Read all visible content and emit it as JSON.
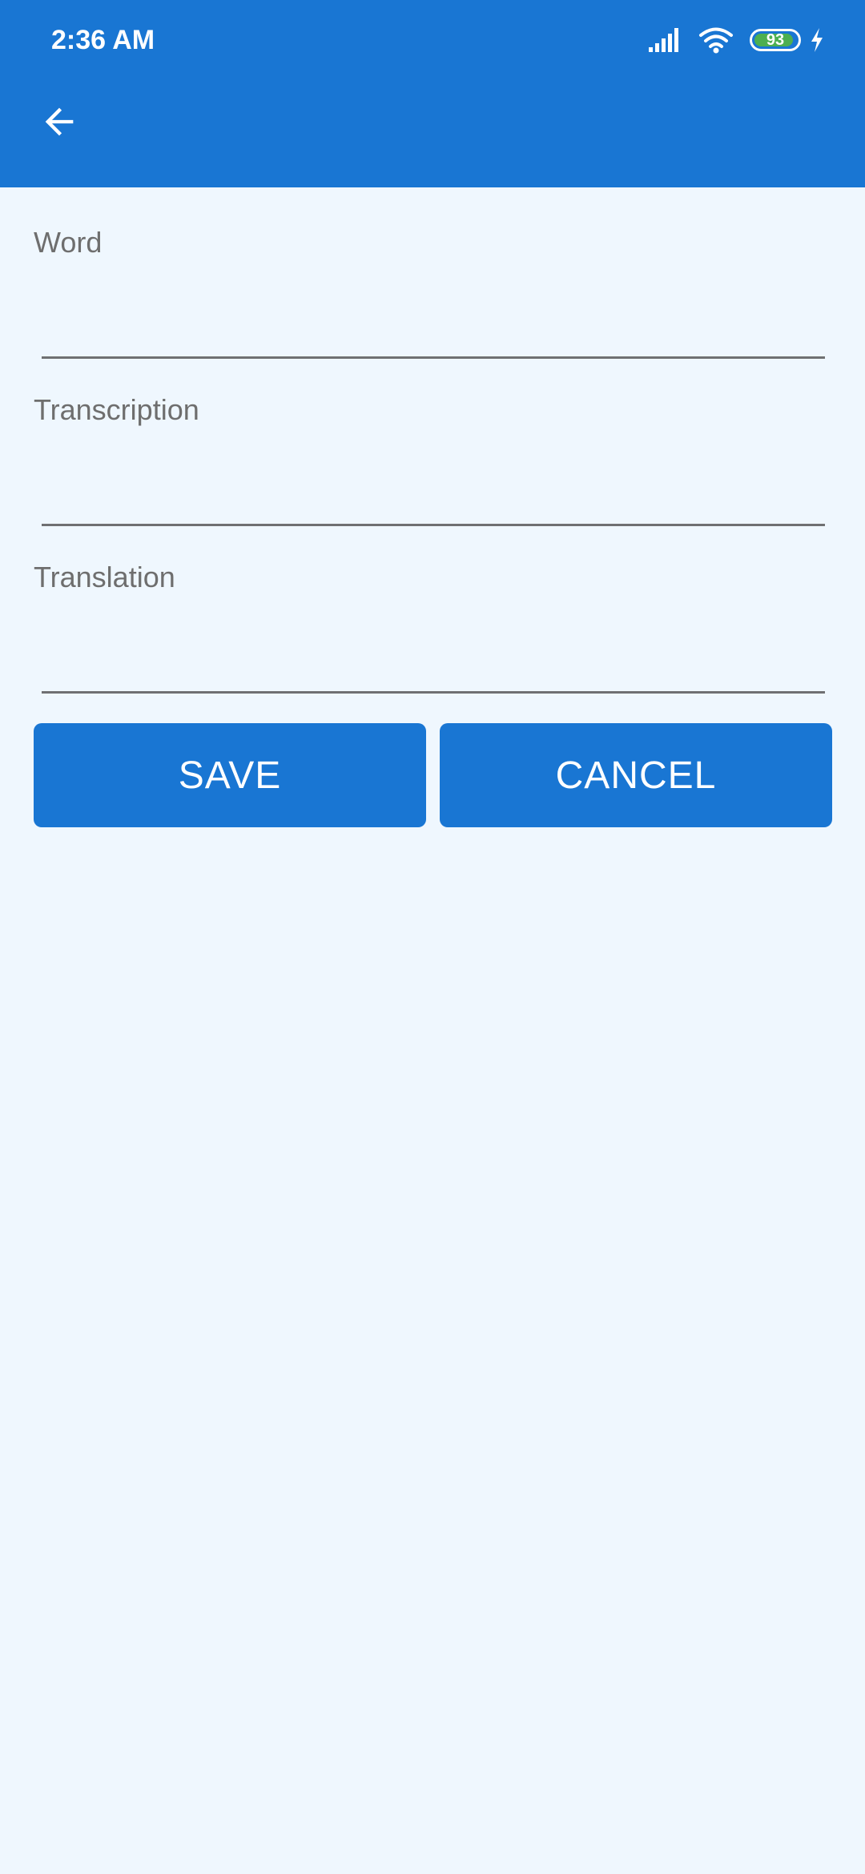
{
  "status_bar": {
    "time": "2:36 AM",
    "battery_level": "93",
    "battery_fraction": 0.93,
    "icons": [
      "signal-icon",
      "wifi-icon",
      "battery-icon",
      "charging-bolt-icon"
    ]
  },
  "app_bar": {
    "back_icon": "arrow-back-icon"
  },
  "form": {
    "word": {
      "label": "Word",
      "value": ""
    },
    "transcription": {
      "label": "Transcription",
      "value": ""
    },
    "translation": {
      "label": "Translation",
      "value": ""
    }
  },
  "actions": {
    "save_label": "SAVE",
    "cancel_label": "CANCEL"
  },
  "colors": {
    "accent": "#1976D3",
    "background": "#EFF7FE",
    "label": "#6E6E6E",
    "underline": "#6F7072",
    "battery_fill": "#4CAF50"
  }
}
